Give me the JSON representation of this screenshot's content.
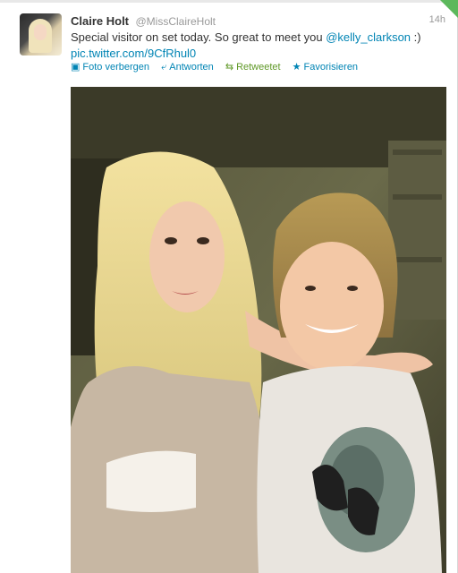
{
  "tweet": {
    "author_name": "Claire Holt",
    "author_handle": "@MissClaireHolt",
    "timestamp": "14h",
    "text_main": "Special visitor on set today. So great to meet you ",
    "mention": "@kelly_clarkson",
    "text_suffix": " :)",
    "link": "pic.twitter.com/9CfRhul0"
  },
  "actions": {
    "hide_photo": "Foto verbergen",
    "reply": "Antworten",
    "retweeted": "Retweetet",
    "favorite": "Favorisieren"
  },
  "icons": {
    "hide_photo": "photo-icon",
    "reply": "reply-arrow-icon",
    "retweeted": "retweet-icon",
    "favorite": "star-icon",
    "corner": "retweeted-corner-icon"
  },
  "colors": {
    "link": "#0084b4",
    "retweeted": "#609928",
    "name": "#333333",
    "meta": "#999999",
    "corner": "#5cb85c"
  }
}
